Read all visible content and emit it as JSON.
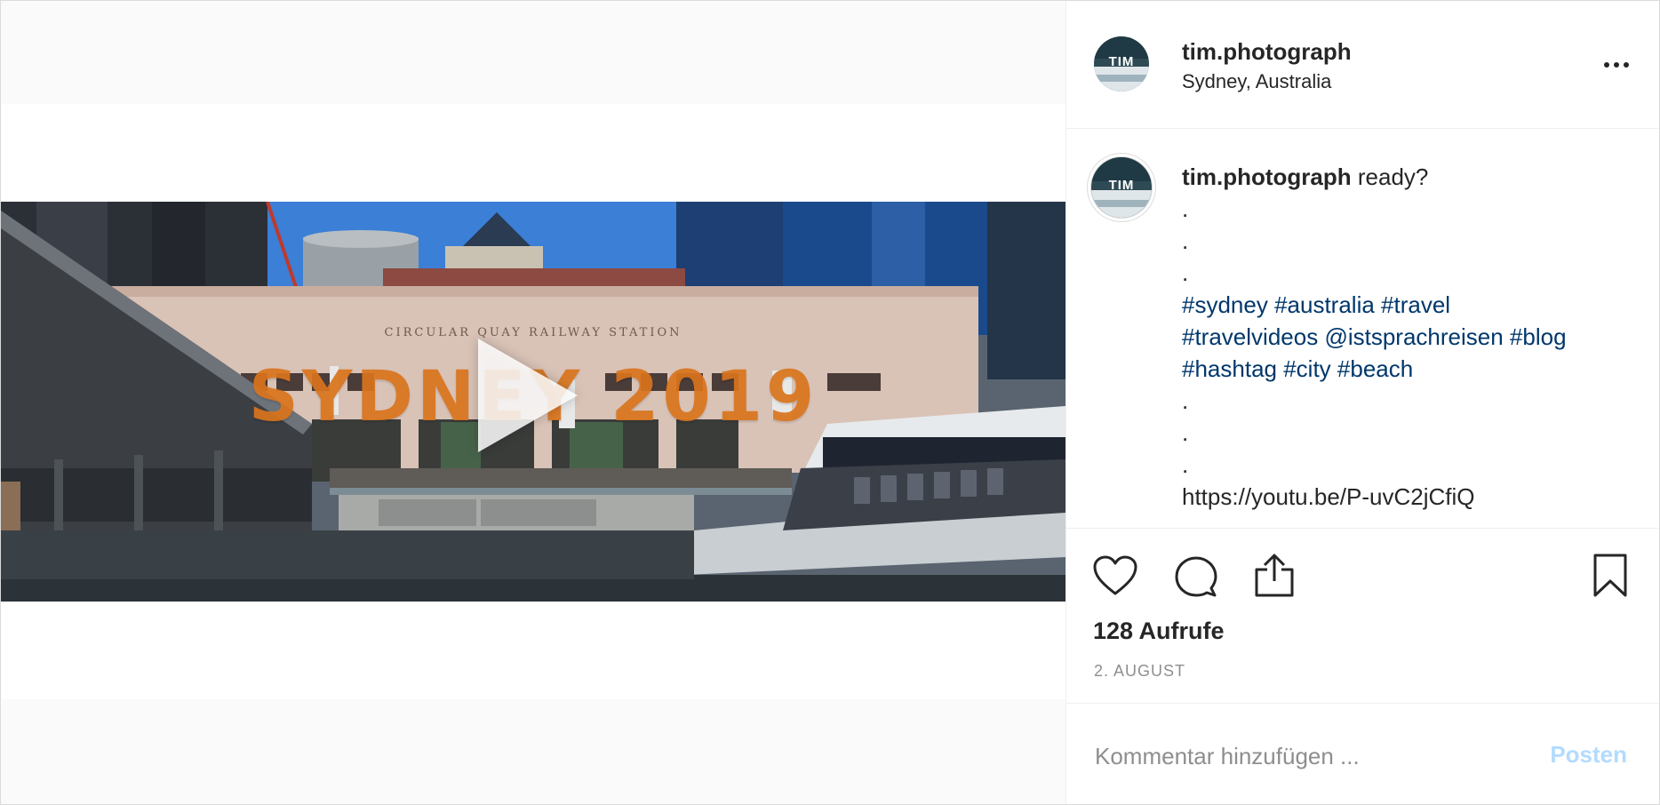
{
  "post": {
    "author": "tim.photograph",
    "avatar_text": "TIM",
    "location": "Sydney, Australia",
    "video": {
      "overlay_title": "SYDNEY 2019",
      "station_sign": "CIRCULAR QUAY RAILWAY STATION"
    },
    "caption": {
      "author": "tim.photograph",
      "text": "ready?",
      "dots": [
        ".",
        ".",
        "."
      ],
      "hashtag_lines": [
        [
          "#sydney",
          "#australia",
          "#travel"
        ],
        [
          "#travelvideos",
          "@istsprachreisen",
          "#blog"
        ],
        [
          "#hashtag",
          "#city",
          "#beach"
        ]
      ],
      "dots_after": [
        ".",
        ".",
        "."
      ],
      "link": "https://youtu.be/P-uvC2jCfiQ"
    },
    "stats": {
      "views": "128 Aufrufe",
      "date": "2. AUGUST"
    },
    "comment": {
      "placeholder": "Kommentar hinzufügen ...",
      "post_label": "Posten"
    }
  },
  "colors": {
    "hashtag": "#00376b",
    "post_button_disabled": "#b3dbff",
    "title_overlay": "#d9741c"
  },
  "icons": [
    "more-icon",
    "heart-icon",
    "comment-icon",
    "share-icon",
    "bookmark-icon",
    "play-icon"
  ]
}
